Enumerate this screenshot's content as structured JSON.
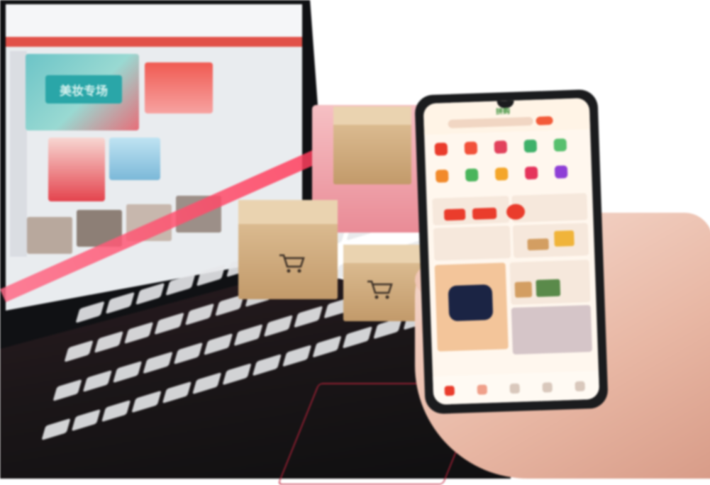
{
  "scene": {
    "description_free": true,
    "laptop": {
      "web_banner_text": "美妆专场"
    },
    "phone": {
      "app_title": "拼购"
    }
  },
  "colors": {
    "laptop_edge": "#ff2f4f",
    "phone_accent": "#ea3c2c",
    "box": "#c29a6a",
    "skin": "#e8b7a4"
  }
}
